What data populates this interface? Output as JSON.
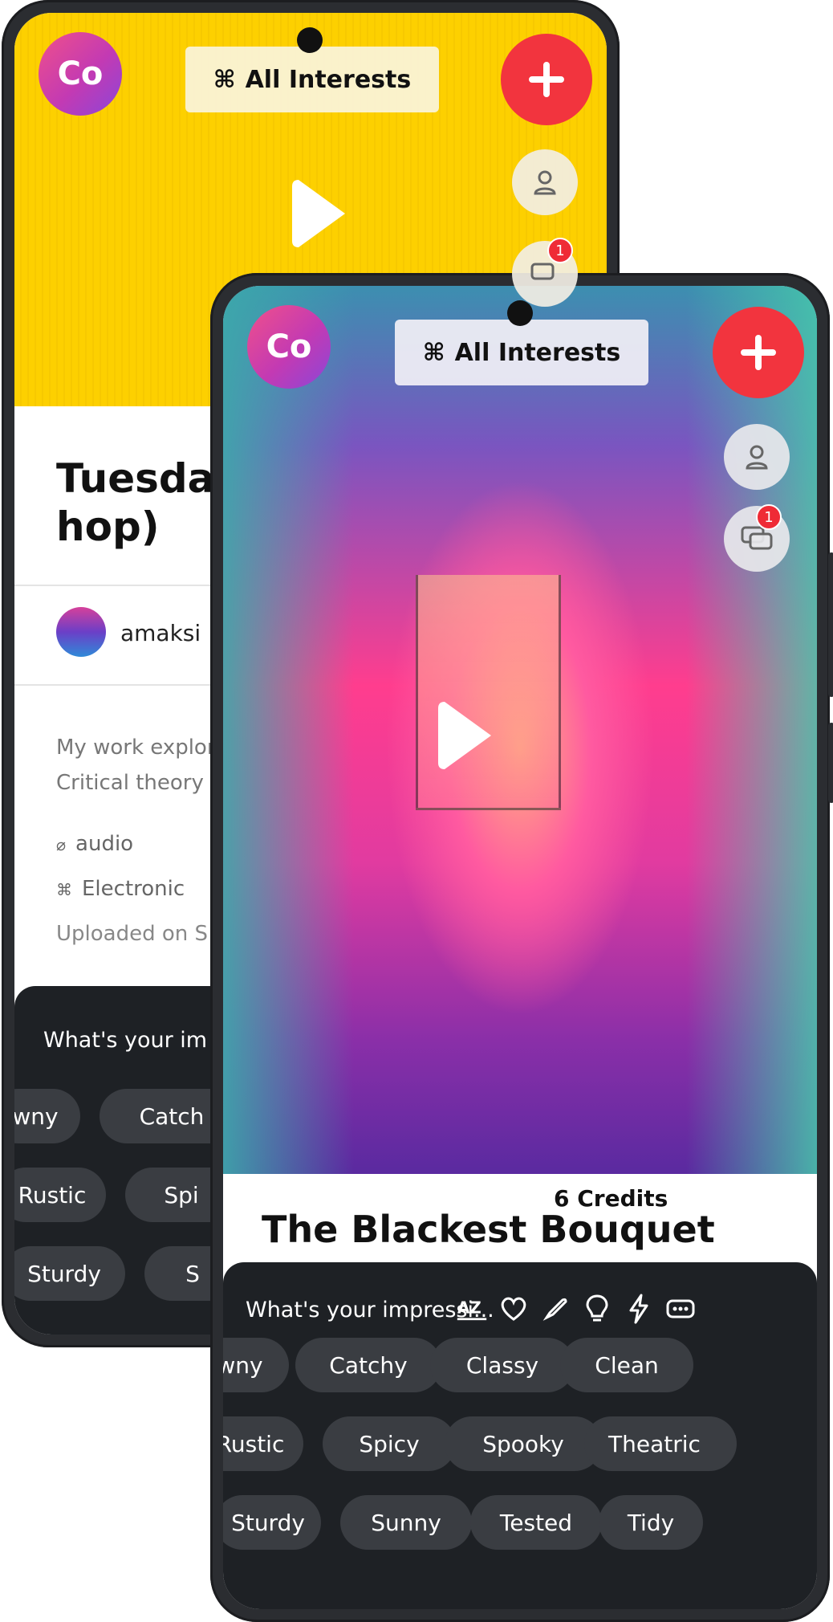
{
  "back_phone": {
    "logo_text": "Co",
    "interests_label": "All Interests",
    "interests_icon": "command-icon",
    "notification_count": "1",
    "title_line1": "Tuesday",
    "title_line2": "hop)",
    "uploader": "amaksi",
    "description_line1": "My work explor",
    "description_line2": "Critical theory a",
    "media_type": "audio",
    "genre": "Electronic",
    "uploaded": "Uploaded on S",
    "impression_question": "What's your im",
    "chips_row1": [
      "wny",
      "Catch"
    ],
    "chips_row2": [
      "Rustic",
      "Spi"
    ],
    "chips_row3": [
      "Sturdy",
      "S"
    ]
  },
  "front_phone": {
    "logo_text": "Co",
    "interests_label": "All Interests",
    "interests_icon": "command-icon",
    "notification_count": "1",
    "credits": "6 Credits",
    "title": "The Blackest Bouquet",
    "impression_question": "What's your impressi...",
    "impression_tools": [
      "az-sort-icon",
      "heart-icon",
      "brush-icon",
      "lightbulb-icon",
      "bolt-icon",
      "more-icon"
    ],
    "chips_row1": [
      "wny",
      "Catchy",
      "Classy",
      "Clean"
    ],
    "chips_row2": [
      "Rustic",
      "Spicy",
      "Spooky",
      "Theatric"
    ],
    "chips_row3": [
      "Sturdy",
      "Sunny",
      "Tested",
      "Tidy"
    ]
  },
  "colors": {
    "brand_red": "#f2343e",
    "yellow": "#fdd000",
    "dark_panel": "#1e2125",
    "chip": "#3a3d42"
  }
}
